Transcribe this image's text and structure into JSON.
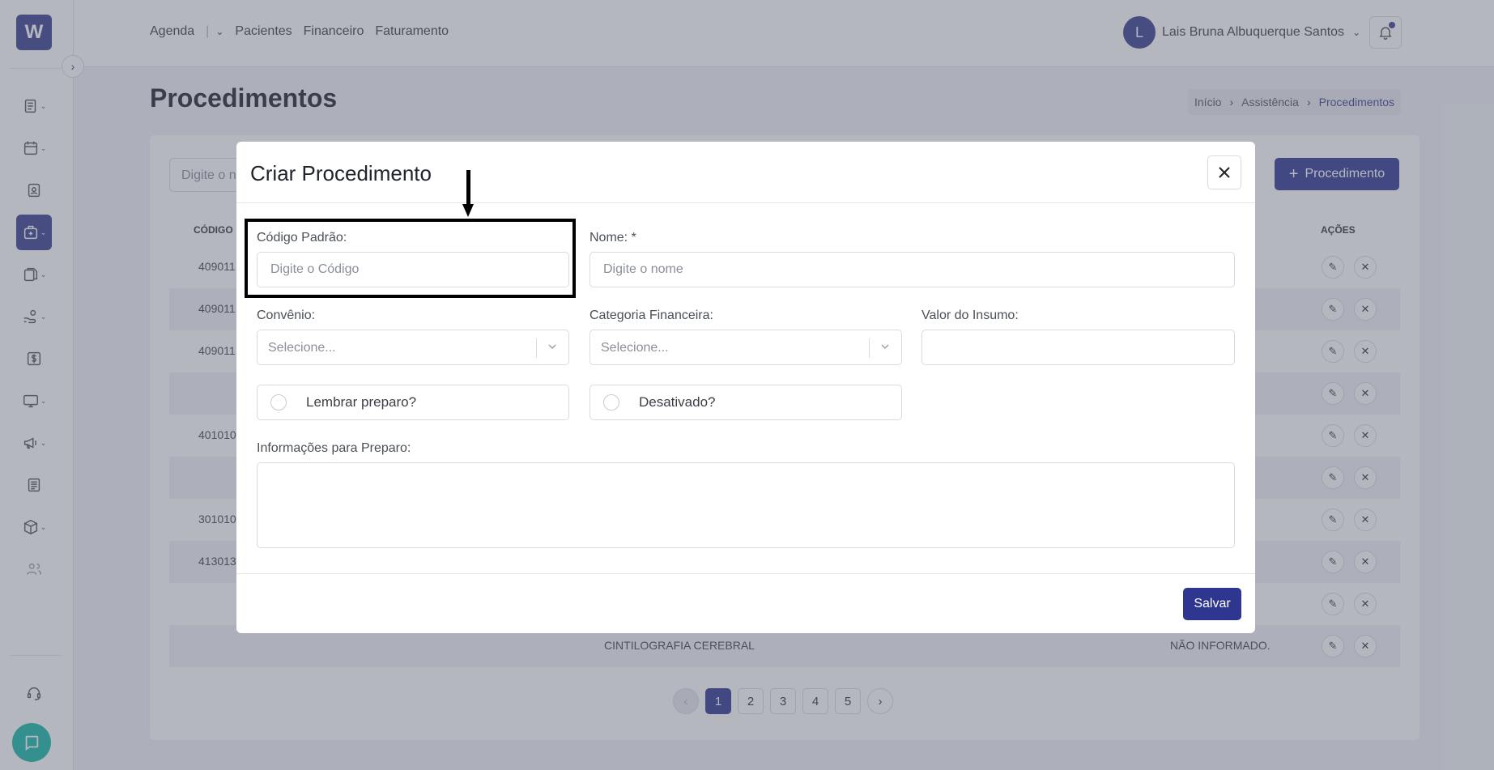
{
  "topbar": {
    "nav": [
      "Agenda",
      "Pacientes",
      "Financeiro",
      "Faturamento"
    ],
    "user_initial": "L",
    "user_name": "Lais Bruna Albuquerque Santos"
  },
  "sidebar": {
    "logo": "W",
    "items": [
      "list-icon",
      "calendar-icon",
      "id-badge-icon",
      "medical-bag-icon",
      "documents-icon",
      "hand-coins-icon",
      "dollar-icon",
      "monitor-icon",
      "megaphone-icon",
      "newspaper-icon",
      "box-icon",
      "users-icon",
      "headset-icon"
    ]
  },
  "page": {
    "title": "Procedimentos",
    "breadcrumb": [
      "Início",
      "Assistência",
      "Procedimentos"
    ]
  },
  "list": {
    "search_placeholder": "Digite o n",
    "add_button": "Procedimento",
    "columns": {
      "code": "CÓDIGO",
      "actions": "AÇÕES"
    },
    "rows": [
      {
        "code": "409011",
        "name": "",
        "conv": ""
      },
      {
        "code": "409011",
        "name": "",
        "conv": ""
      },
      {
        "code": "409011",
        "name": "",
        "conv": ""
      },
      {
        "code": "",
        "name": "",
        "conv": ""
      },
      {
        "code": "401010",
        "name": "",
        "conv": ""
      },
      {
        "code": "",
        "name": "",
        "conv": ""
      },
      {
        "code": "301010",
        "name": "",
        "conv": ""
      },
      {
        "code": "413013",
        "name": "",
        "conv": ""
      },
      {
        "code": "",
        "name": "",
        "conv": ""
      },
      {
        "code": "",
        "name": "CINTILOGRAFIA CEREBRAL",
        "conv": "NÃO INFORMADO."
      }
    ],
    "pages": [
      "1",
      "2",
      "3",
      "4",
      "5"
    ]
  },
  "modal": {
    "title": "Criar Procedimento",
    "codigo_label": "Código Padrão:",
    "codigo_placeholder": "Digite o Código",
    "nome_label": "Nome: *",
    "nome_placeholder": "Digite o nome",
    "convenio_label": "Convênio:",
    "convenio_placeholder": "Selecione...",
    "categoria_label": "Categoria Financeira:",
    "categoria_placeholder": "Selecione...",
    "valor_label": "Valor do Insumo:",
    "lembrar_label": "Lembrar preparo?",
    "desativado_label": "Desativado?",
    "info_label": "Informações para Preparo:",
    "save_label": "Salvar"
  }
}
